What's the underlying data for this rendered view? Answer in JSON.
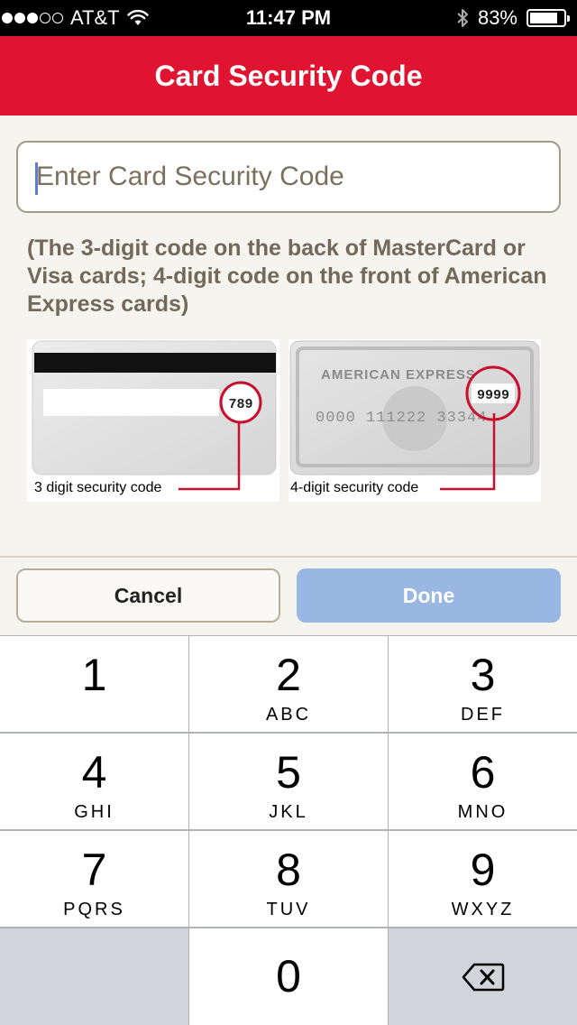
{
  "status_bar": {
    "carrier": "AT&T",
    "time": "11:47 PM",
    "battery": "83%",
    "battery_level": 0.83
  },
  "header": {
    "title": "Card Security Code"
  },
  "security_code": {
    "placeholder": "Enter Card Security Code",
    "value": ""
  },
  "help_text": "(The 3-digit code on the back of MasterCard or Visa cards; 4-digit code on the front of American Express cards)",
  "card_examples": {
    "back": {
      "code": "789",
      "caption": "3 digit security code"
    },
    "amex": {
      "brand": "AMERICAN EXPRESS",
      "code": "9999",
      "number": "0000 111222 33344",
      "caption": "4-digit security code"
    }
  },
  "actions": {
    "cancel": "Cancel",
    "done": "Done"
  },
  "keypad": {
    "keys": [
      {
        "num": "1",
        "letters": ""
      },
      {
        "num": "2",
        "letters": "ABC"
      },
      {
        "num": "3",
        "letters": "DEF"
      },
      {
        "num": "4",
        "letters": "GHI"
      },
      {
        "num": "5",
        "letters": "JKL"
      },
      {
        "num": "6",
        "letters": "MNO"
      },
      {
        "num": "7",
        "letters": "PQRS"
      },
      {
        "num": "8",
        "letters": "TUV"
      },
      {
        "num": "9",
        "letters": "WXYZ"
      },
      {
        "num": "0",
        "letters": ""
      }
    ],
    "backspace_icon": "backspace-icon"
  },
  "colors": {
    "header_red": "#e01430",
    "done_blue": "#98b8e3",
    "help_text": "#73695a"
  }
}
